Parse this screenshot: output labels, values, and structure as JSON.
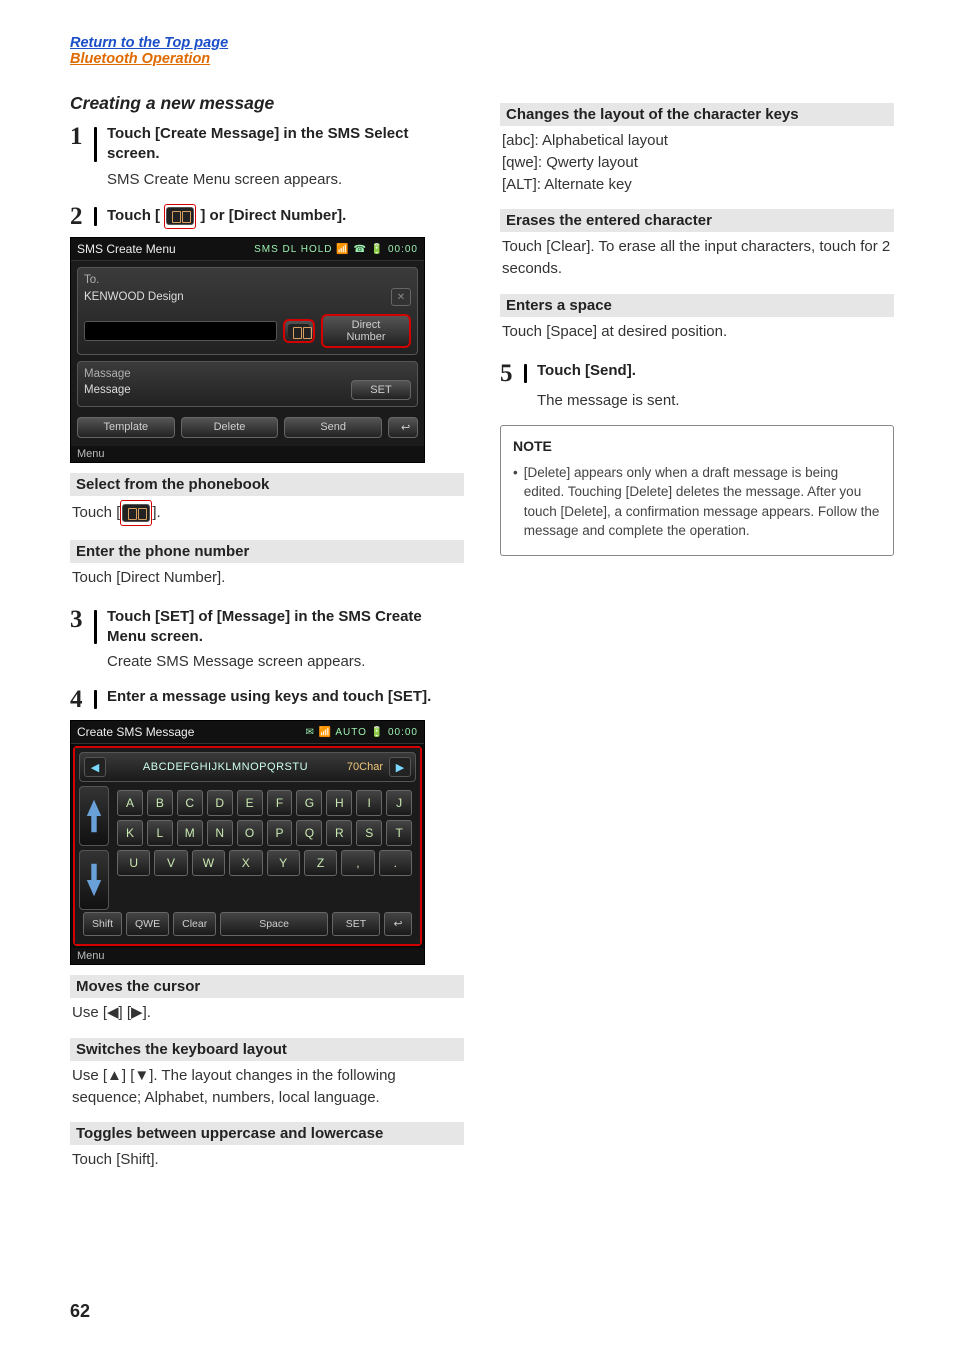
{
  "top_links": {
    "return": "Return to the Top page",
    "section": "Bluetooth Operation"
  },
  "heading": "Creating a new message",
  "left": {
    "step1": {
      "num": "1",
      "title": "Touch [Create Message] in the SMS Select screen.",
      "follow": "SMS Create Menu screen appears."
    },
    "step2": {
      "num": "2",
      "title_pre": "Touch [ ",
      "title_post": " ] or [Direct Number].",
      "ss": {
        "title": "SMS Create Menu",
        "icons": "SMS  DL HOLD  📶  ☎  🔋  00:00",
        "to_label": "To.",
        "to_value": "KENWOOD Design",
        "pb_btn": "",
        "direct_btn": "Direct Number",
        "massage_label": "Massage",
        "message_label": "Message",
        "set_btn": "SET",
        "template_btn": "Template",
        "delete_btn": "Delete",
        "send_btn": "Send",
        "back_icon": "↩",
        "menu": "Menu"
      },
      "sub1_head": "Select from the phonebook",
      "sub1_body_pre": "Touch [",
      "sub1_body_post": "].",
      "sub2_head": "Enter the phone number",
      "sub2_body": "Touch [Direct Number]."
    },
    "step3": {
      "num": "3",
      "title": "Touch [SET] of [Message] in the SMS Create Menu screen.",
      "follow": "Create SMS Message screen appears."
    },
    "step4": {
      "num": "4",
      "title": "Enter a message using keys and touch [SET].",
      "ss": {
        "title": "Create SMS Message",
        "icons": "✉       📶   AUTO 🔋   00:00",
        "alpha_row": "ABCDEFGHIJKLMNOPQRSTU",
        "char_count": "70Char",
        "row1": [
          "A",
          "B",
          "C",
          "D",
          "E",
          "F",
          "G",
          "H",
          "I",
          "J"
        ],
        "row2": [
          "K",
          "L",
          "M",
          "N",
          "O",
          "P",
          "Q",
          "R",
          "S",
          "T"
        ],
        "row3": [
          "U",
          "V",
          "W",
          "X",
          "Y",
          "Z",
          ",",
          "."
        ],
        "shift": "Shift",
        "qwe": "QWE",
        "clear": "Clear",
        "space": "Space",
        "set": "SET",
        "back": "↩",
        "menu": "Menu"
      },
      "sub1_head": "Moves the cursor",
      "sub1_body": "Use [◀] [▶].",
      "sub2_head": "Switches the keyboard layout",
      "sub2_body": "Use [▲] [▼]. The layout changes in the following sequence; Alphabet, numbers, local language.",
      "sub3_head": "Toggles between uppercase and lowercase",
      "sub3_body": "Touch [Shift]."
    }
  },
  "right": {
    "s1_head": "Changes the layout of the character keys",
    "s1_l1_b": "[abc]",
    "s1_l1_t": ": Alphabetical layout",
    "s1_l2_b": "[qwe]",
    "s1_l2_t": ": Qwerty layout",
    "s1_l3_b": "[ALT]",
    "s1_l3_t": ": Alternate key",
    "s2_head": "Erases the entered character",
    "s2_body": "Touch [Clear]. To erase all the input characters, touch for 2 seconds.",
    "s3_head": "Enters a space",
    "s3_body": "Touch [Space] at desired position.",
    "step5": {
      "num": "5",
      "title": "Touch [Send].",
      "follow": "The message is sent."
    },
    "note_title": "NOTE",
    "note_body": "[Delete] appears only when a draft message is being edited. Touching [Delete] deletes the message. After you touch [Delete], a confirmation message appears. Follow the message and complete the operation."
  },
  "pagenum": "62"
}
